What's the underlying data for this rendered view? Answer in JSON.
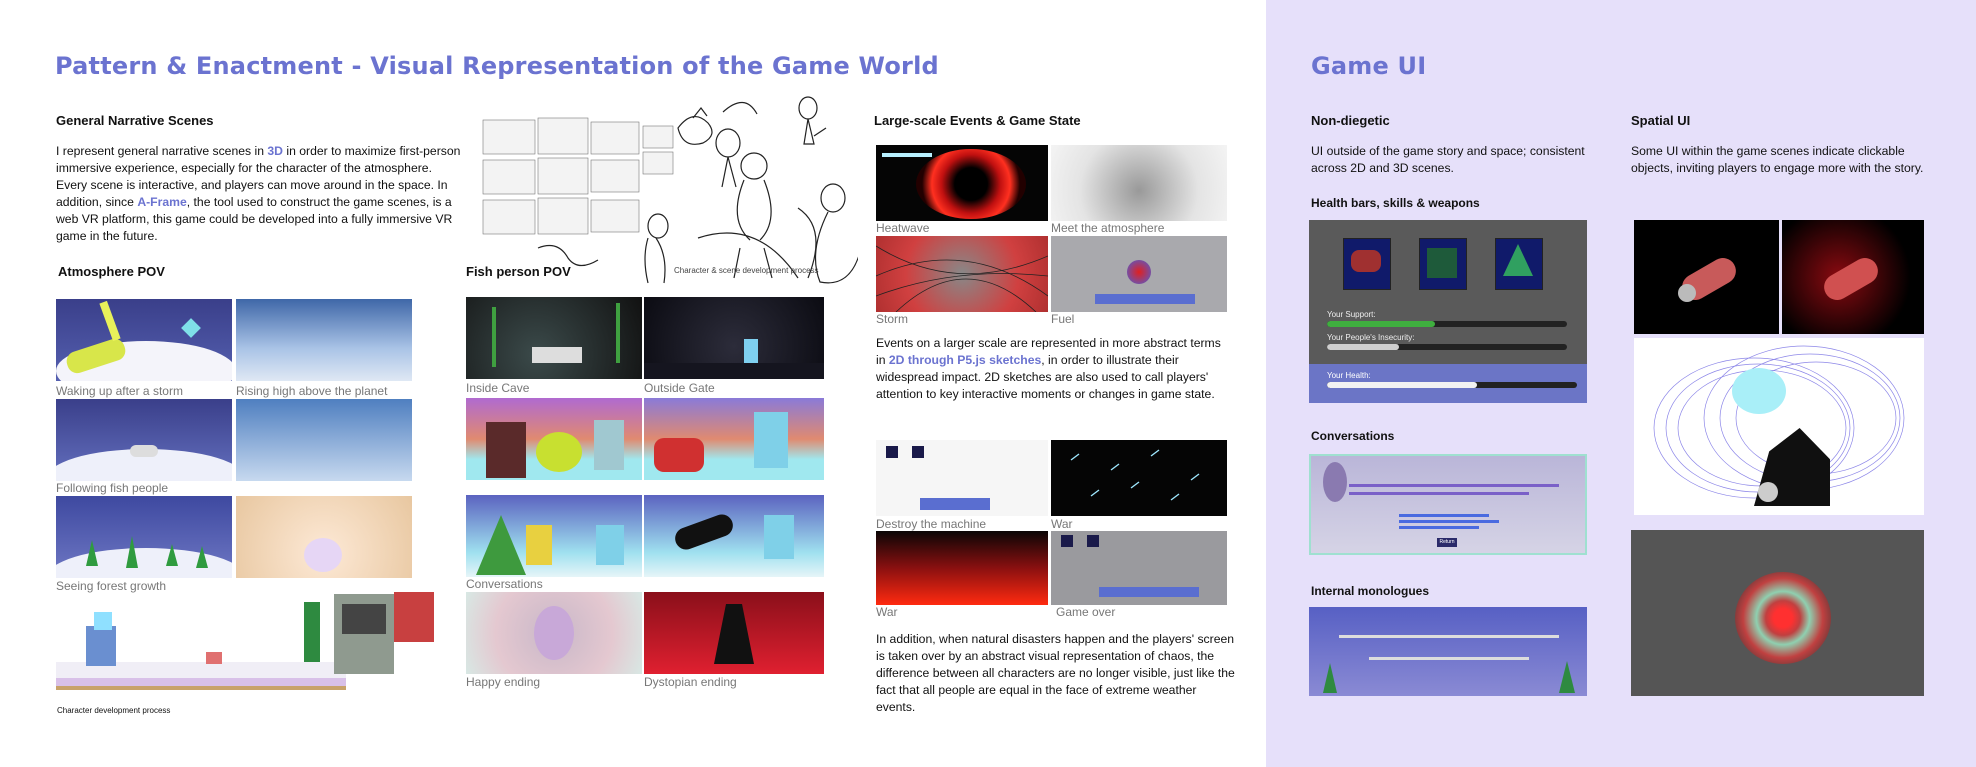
{
  "left": {
    "title": "Pattern & Enactment - Visual Representation of the Game World",
    "narrative": {
      "heading": "General Narrative Scenes",
      "p1": "I represent general narrative scenes in ",
      "link1": "3D",
      "p2": " in order to maximize first-person immersive experience, especially for the character of the atmosphere. Every scene is interactive, and players can move around in the space. In addition, since ",
      "link2": "A-Frame",
      "p3": ", the tool used to construct the game scenes, is a web VR platform, this game could be developed into a fully immersive VR game in the future."
    },
    "sketch_caption": "Character & scene development process",
    "atmosphere": {
      "heading": "Atmosphere POV",
      "captions": [
        "Waking up after a storm",
        "Rising high above the planet",
        "Following fish people",
        "Seeing forest growth"
      ]
    },
    "pixel_caption": "Character development process",
    "fish": {
      "heading": "Fish person POV",
      "captions": [
        "Inside Cave",
        "Outside Gate",
        "Conversations",
        "Happy ending",
        "Dystopian ending"
      ]
    },
    "events": {
      "heading": "Large-scale Events & Game State",
      "captions_top": [
        "Heatwave",
        "Meet the atmosphere",
        "Storm",
        "Fuel"
      ],
      "p1": "Events on a larger scale are represented in more abstract terms in ",
      "link": "2D through P5.js sketches",
      "p2": ", in order to illustrate their widespread impact. 2D sketches are also used to call players' attention to key interactive moments or changes in game state.",
      "captions_bottom": [
        "Destroy the machine",
        "War",
        "War",
        "Game over"
      ],
      "p3": "In addition, when natural disasters happen and the players' screen is taken over by an abstract visual representation of chaos, the difference between all characters are no longer visible, just like the fact that all people are equal in the face of extreme weather events."
    }
  },
  "right": {
    "title": "Game UI",
    "nondiegetic": {
      "heading": "Non-diegetic",
      "text": "UI outside of the game story and space; consistent across 2D and 3D scenes."
    },
    "spatial": {
      "heading": "Spatial UI",
      "text": "Some UI within the game scenes indicate clickable objects, inviting players to engage more with the story."
    },
    "health": {
      "heading": "Health bars, skills & weapons",
      "labels": [
        "Your Support:",
        "Your People's Insecurity:",
        "Your Health:"
      ],
      "levels": [
        0.45,
        0.3,
        0.6
      ]
    },
    "conversations": {
      "heading": "Conversations",
      "button": "Return"
    },
    "monologues": {
      "heading": "Internal monologues"
    }
  },
  "colors": {
    "accent": "#6b73d0",
    "panel": "#e6e0fa"
  }
}
